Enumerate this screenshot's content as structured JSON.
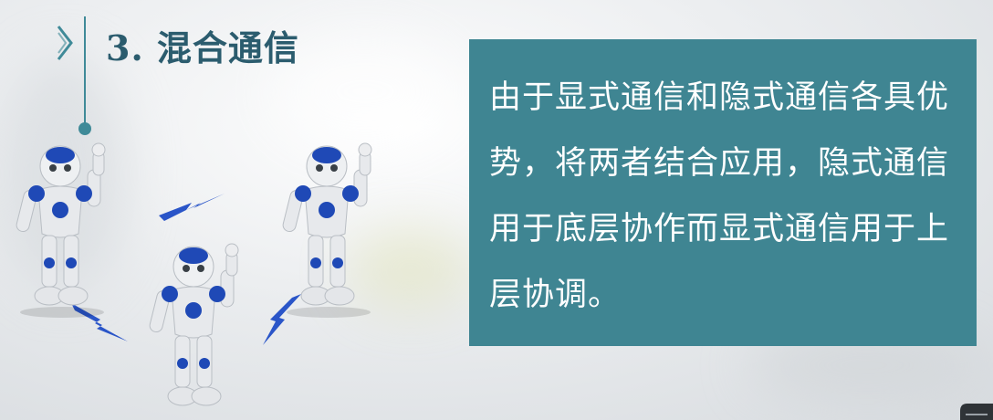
{
  "header": {
    "title": "3. 混合通信",
    "chevron_icon": "chevron-right-icon"
  },
  "panel": {
    "text": "由于显式通信和隐式通信各具优势，将两者结合应用，隐式通信用于底层协作而显式通信用于上层协调。"
  },
  "illustration": {
    "robot_icon": "humanoid-robot-icon",
    "lightning_icon": "lightning-bolt-icon",
    "robot_count": 3,
    "lightning_count": 3
  },
  "colors": {
    "accent": "#3f8a98",
    "title": "#2b5c6e",
    "panel_bg": "#3f8592",
    "panel_text": "#ffffff",
    "robot_blue": "#1f49b6",
    "lightning": "#2a55c8"
  }
}
